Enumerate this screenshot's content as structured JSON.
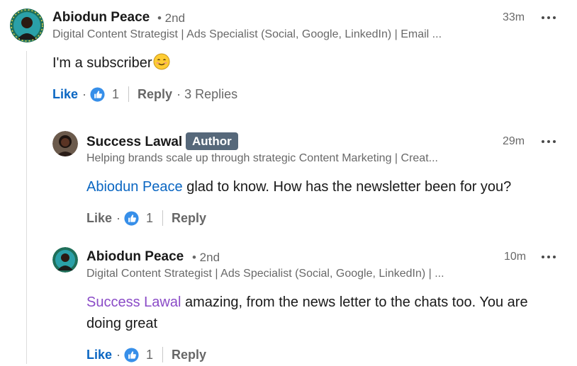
{
  "comment": {
    "author": "Abiodun Peace",
    "degree": "• 2nd",
    "headline": "Digital Content Strategist | Ads Specialist (Social, Google, LinkedIn) | Email ...",
    "time": "33m",
    "text": "I'm a subscriber",
    "emoji": "smiling-face",
    "like_label": "Like",
    "reaction_count": "1",
    "reply_label": "Reply",
    "replies_label": "3 Replies"
  },
  "replies": [
    {
      "author": "Success Lawal",
      "badge": "Author",
      "headline": "Helping brands scale up through strategic Content Marketing | Creat...",
      "time": "29m",
      "mention": "Abiodun Peace",
      "text": " glad to know. How has the newsletter been for you?",
      "like_label": "Like",
      "reaction_count": "1",
      "reply_label": "Reply"
    },
    {
      "author": "Abiodun Peace",
      "degree": "• 2nd",
      "headline": "Digital Content Strategist | Ads Specialist (Social, Google, LinkedIn) | ...",
      "time": "10m",
      "mention": "Success Lawal",
      "text": " amazing, from the news letter to the chats too. You are doing great",
      "like_label": "Like",
      "reaction_count": "1",
      "reply_label": "Reply"
    }
  ],
  "colors": {
    "link_blue": "#0a66c2",
    "visited_mention": "#8a4bc7",
    "author_badge": "#56687a",
    "like_icon": "#378fe9"
  }
}
